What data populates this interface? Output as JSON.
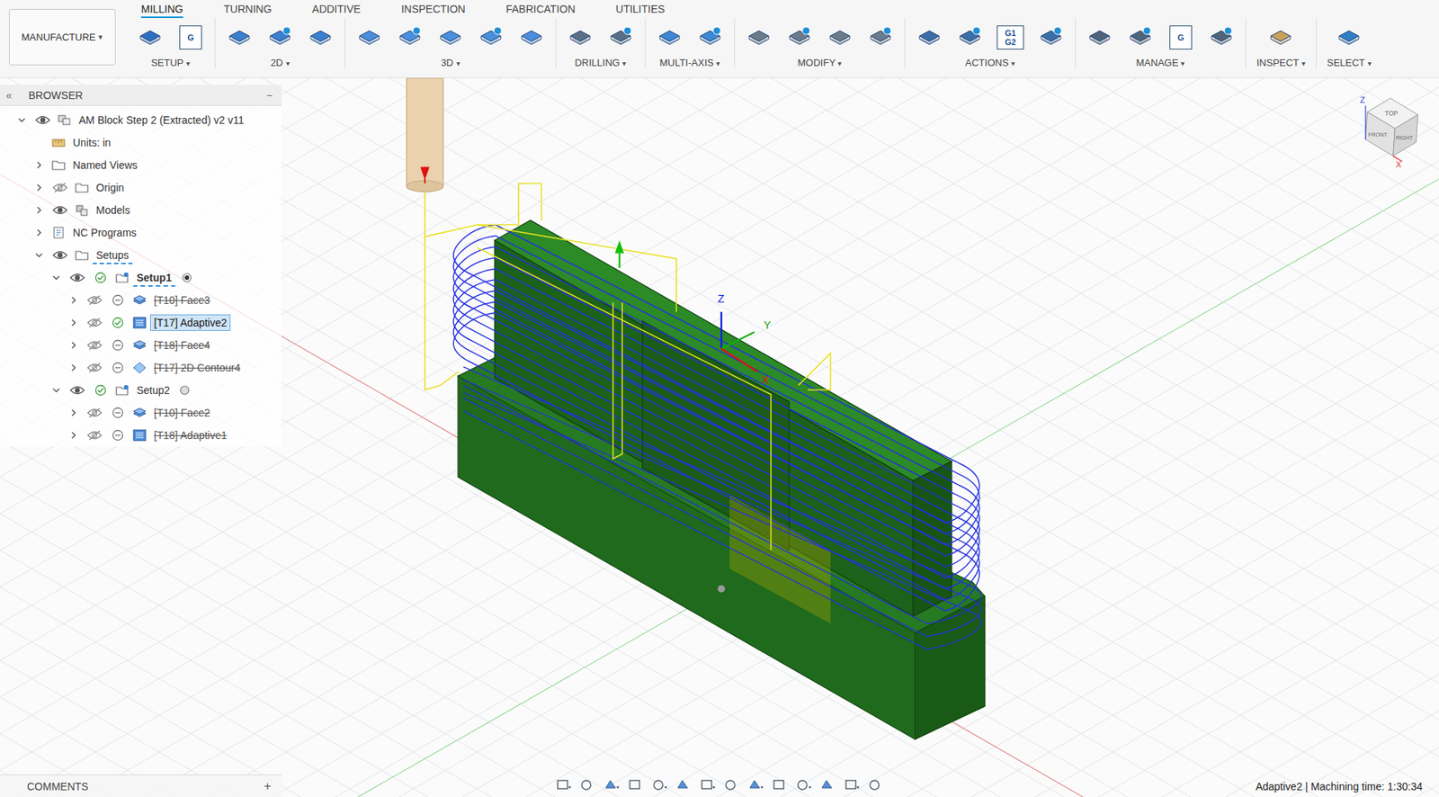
{
  "window": {
    "title": "AM Block Step 2 (Extracted) v2 v11"
  },
  "workspace": {
    "label": "MANUFACTURE",
    "menu": "▾"
  },
  "tabs": [
    {
      "label": "MILLING",
      "selected": true
    },
    {
      "label": "TURNING",
      "selected": false
    },
    {
      "label": "ADDITIVE",
      "selected": false
    },
    {
      "label": "INSPECTION",
      "selected": false
    },
    {
      "label": "FABRICATION",
      "selected": false
    },
    {
      "label": "UTILITIES",
      "selected": false
    }
  ],
  "groups": [
    {
      "label": "SETUP",
      "menu": "▾",
      "icons": [
        {},
        {
          "text": "G"
        }
      ]
    },
    {
      "label": "2D",
      "menu": "▾",
      "icons": [
        {},
        {},
        {}
      ]
    },
    {
      "label": "3D",
      "menu": "▾",
      "icons": [
        {},
        {},
        {},
        {},
        {}
      ]
    },
    {
      "label": "DRILLING",
      "menu": "▾",
      "icons": [
        {},
        {}
      ]
    },
    {
      "label": "MULTI-AXIS",
      "menu": "▾",
      "icons": [
        {},
        {}
      ]
    },
    {
      "label": "MODIFY",
      "menu": "▾",
      "icons": [
        {},
        {},
        {},
        {}
      ]
    },
    {
      "label": "ACTIONS",
      "menu": "▾",
      "icons": [
        {},
        {},
        {
          "text": "G1 G2"
        },
        {}
      ]
    },
    {
      "label": "MANAGE",
      "menu": "▾",
      "icons": [
        {},
        {},
        {
          "text": "G"
        },
        {}
      ]
    },
    {
      "label": "INSPECT",
      "menu": "▾",
      "icons": [
        {}
      ]
    },
    {
      "label": "SELECT",
      "menu": "▾",
      "icons": [
        {}
      ]
    }
  ],
  "browser": {
    "title": "BROWSER",
    "collapse": "«",
    "minimize": "−",
    "items": [
      {
        "label": "AM Block Step 2 (Extracted) v2 v11",
        "depth": 0,
        "kind": "component",
        "expandable": true,
        "expanded": true,
        "visibility": "shown",
        "status": "absent",
        "selected": false,
        "struck": false,
        "busy": false
      },
      {
        "label": "Units: in",
        "depth": 1,
        "kind": "units",
        "expandable": false,
        "expanded": false,
        "visibility": "absent",
        "status": "absent",
        "selected": false,
        "struck": false,
        "busy": false
      },
      {
        "label": "Named Views",
        "depth": 1,
        "kind": "folder",
        "expandable": true,
        "expanded": false,
        "visibility": "absent",
        "status": "absent",
        "selected": false,
        "struck": false,
        "busy": false
      },
      {
        "label": "Origin",
        "depth": 1,
        "kind": "folder",
        "expandable": true,
        "expanded": false,
        "visibility": "hidden",
        "status": "absent",
        "selected": false,
        "struck": false,
        "busy": false
      },
      {
        "label": "Models",
        "depth": 1,
        "kind": "models",
        "expandable": true,
        "expanded": false,
        "visibility": "shown",
        "status": "absent",
        "selected": false,
        "struck": false,
        "busy": false
      },
      {
        "label": "NC Programs",
        "depth": 1,
        "kind": "nc",
        "expandable": true,
        "expanded": false,
        "visibility": "absent",
        "status": "absent",
        "selected": false,
        "struck": false,
        "busy": false
      },
      {
        "label": "Setups",
        "depth": 1,
        "kind": "folder",
        "expandable": true,
        "expanded": true,
        "visibility": "shown",
        "status": "absent",
        "selected": false,
        "struck": false,
        "busy": true
      },
      {
        "label": "Setup1",
        "depth": 2,
        "kind": "setup",
        "expandable": true,
        "expanded": true,
        "visibility": "shown",
        "status": "ok",
        "selected": false,
        "struck": false,
        "busy": true,
        "active": true
      },
      {
        "label": "[T10] Face3",
        "depth": 3,
        "kind": "face",
        "expandable": true,
        "expanded": false,
        "visibility": "hidden",
        "status": "off",
        "selected": false,
        "struck": true,
        "busy": false
      },
      {
        "label": "[T17] Adaptive2",
        "depth": 3,
        "kind": "adaptive",
        "expandable": true,
        "expanded": false,
        "visibility": "hidden",
        "status": "ok",
        "selected": true,
        "struck": false,
        "busy": false
      },
      {
        "label": "[T18] Face4",
        "depth": 3,
        "kind": "face",
        "expandable": true,
        "expanded": false,
        "visibility": "hidden",
        "status": "off",
        "selected": false,
        "struck": true,
        "busy": false
      },
      {
        "label": "[T17] 2D Contour4",
        "depth": 3,
        "kind": "contour",
        "expandable": true,
        "expanded": false,
        "visibility": "hidden",
        "status": "off",
        "selected": false,
        "struck": true,
        "busy": false
      },
      {
        "label": "Setup2",
        "depth": 2,
        "kind": "setup",
        "expandable": true,
        "expanded": true,
        "visibility": "shown",
        "status": "ok",
        "selected": false,
        "struck": false,
        "busy": false,
        "active": false
      },
      {
        "label": "[T10] Face2",
        "depth": 3,
        "kind": "face",
        "expandable": true,
        "expanded": false,
        "visibility": "hidden",
        "status": "off",
        "selected": false,
        "struck": true,
        "busy": false
      },
      {
        "label": "[T18] Adaptive1",
        "depth": 3,
        "kind": "adaptive",
        "expandable": true,
        "expanded": false,
        "visibility": "hidden",
        "status": "off",
        "selected": false,
        "struck": true,
        "busy": false
      }
    ]
  },
  "comments": {
    "title": "COMMENTS",
    "add": "+"
  },
  "status_bar": {
    "text": "Adaptive2 | Machining time: 1:30:34"
  },
  "view_cube": {
    "faces": [
      "TOP",
      "FRONT",
      "RIGHT"
    ],
    "axes": [
      "Z",
      "X"
    ]
  },
  "triad": {
    "axes": [
      "Z",
      "Y",
      "X"
    ]
  }
}
